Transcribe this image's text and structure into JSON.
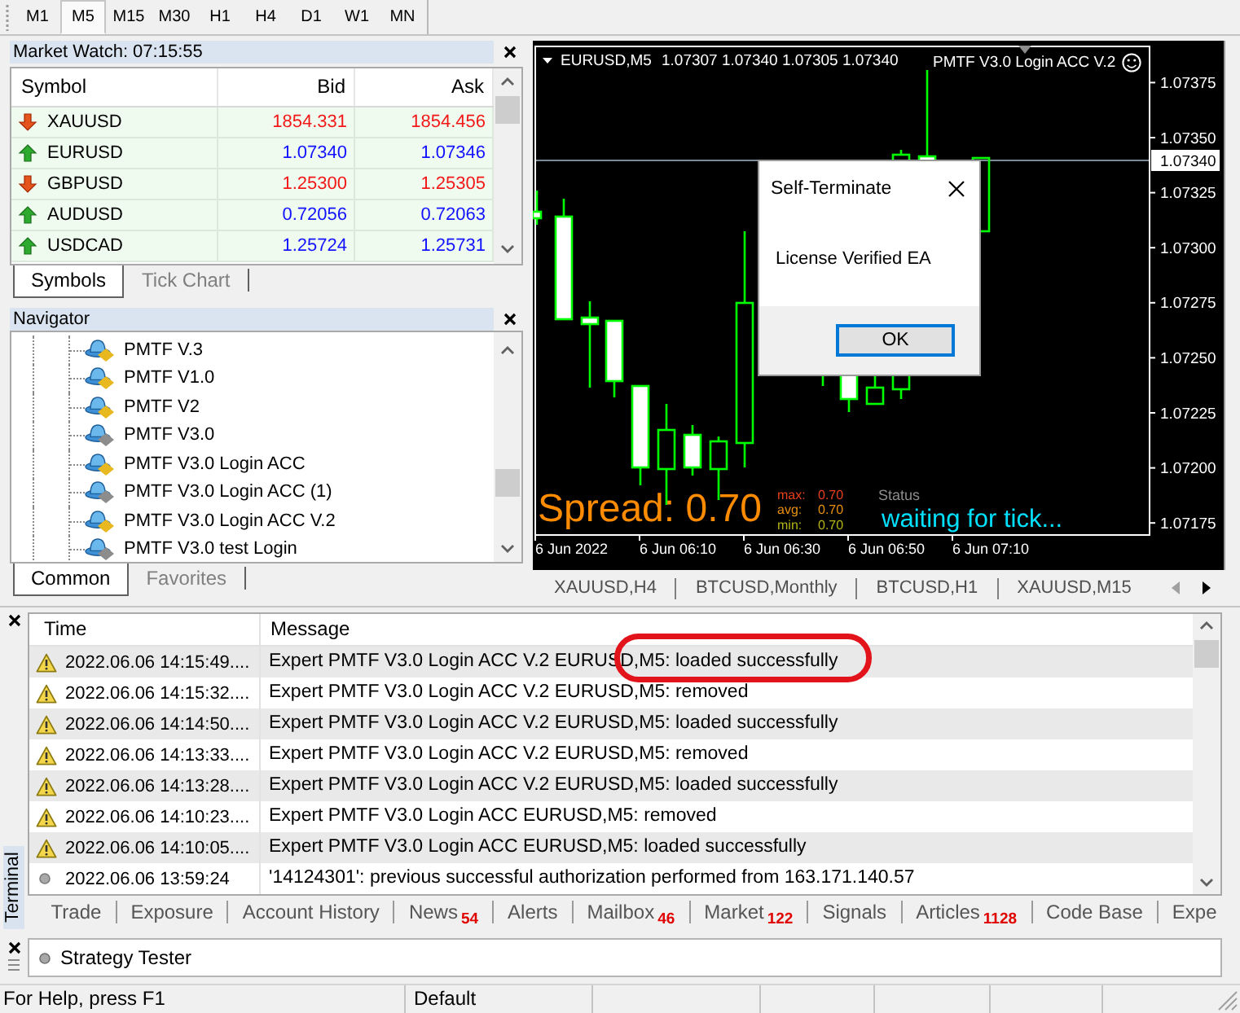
{
  "toolbar": {
    "timeframes": [
      {
        "label": "M1",
        "selected": false
      },
      {
        "label": "M5",
        "selected": true
      },
      {
        "label": "M15",
        "selected": false
      },
      {
        "label": "M30",
        "selected": false
      },
      {
        "label": "H1",
        "selected": false
      },
      {
        "label": "H4",
        "selected": false
      },
      {
        "label": "D1",
        "selected": false
      },
      {
        "label": "W1",
        "selected": false
      },
      {
        "label": "MN",
        "selected": false
      }
    ]
  },
  "market_watch": {
    "title": "Market Watch: 07:15:55",
    "columns": [
      "Symbol",
      "Bid",
      "Ask"
    ],
    "rows": [
      {
        "symbol": "XAUUSD",
        "kind": "down",
        "bid": "1854.331",
        "ask": "1854.456"
      },
      {
        "symbol": "EURUSD",
        "kind": "up",
        "bid": "1.07340",
        "ask": "1.07346"
      },
      {
        "symbol": "GBPUSD",
        "kind": "down",
        "bid": "1.25300",
        "ask": "1.25305"
      },
      {
        "symbol": "AUDUSD",
        "kind": "up",
        "bid": "0.72056",
        "ask": "0.72063"
      },
      {
        "symbol": "USDCAD",
        "kind": "up",
        "bid": "1.25724",
        "ask": "1.25731"
      }
    ],
    "tabs": [
      {
        "label": "Symbols",
        "selected": true
      },
      {
        "label": "Tick Chart",
        "selected": false
      }
    ]
  },
  "navigator": {
    "title": "Navigator",
    "items": [
      {
        "label": "PMTF V.3",
        "color": "#e8b820"
      },
      {
        "label": "PMTF V1.0",
        "color": "#e8b820"
      },
      {
        "label": "PMTF V2",
        "color": "#e8b820"
      },
      {
        "label": "PMTF V3.0",
        "color": "#8c8c8c"
      },
      {
        "label": "PMTF V3.0 Login ACC",
        "color": "#e8b820"
      },
      {
        "label": "PMTF V3.0 Login ACC (1)",
        "color": "#8c8c8c"
      },
      {
        "label": "PMTF V3.0 Login ACC V.2",
        "color": "#e8b820"
      },
      {
        "label": "PMTF V3.0 test Login",
        "color": "#8c8c8c"
      }
    ],
    "tabs": [
      {
        "label": "Common",
        "selected": true
      },
      {
        "label": "Favorites",
        "selected": false
      }
    ]
  },
  "chart": {
    "symbol": "EURUSD,M5",
    "ohlc": "1.07307 1.07340 1.07305 1.07340",
    "expert": "PMTF V3.0 Login ACC V.2",
    "price_labels": [
      "1.07375",
      "1.07350",
      "1.07325",
      "1.07300",
      "1.07275",
      "1.07250",
      "1.07225",
      "1.07200",
      "1.07175"
    ],
    "current_price": "1.07340",
    "time_labels": [
      "6 Jun 2022",
      "6 Jun 06:10",
      "6 Jun 06:30",
      "6 Jun 06:50",
      "6 Jun 07:10"
    ],
    "spread": "Spread: 0.70",
    "spread_stats": [
      {
        "label": "max:",
        "value": "0.70",
        "color": "#e8401c"
      },
      {
        "label": "avg:",
        "value": "0.70",
        "color": "#e8900c"
      },
      {
        "label": "min:",
        "value": "0.70",
        "color": "#b4b414"
      }
    ],
    "status_label": "Status",
    "status": "waiting for tick...",
    "dialog": {
      "title": "Self-Terminate",
      "message": "License Verified EA",
      "button": "OK"
    },
    "tabs": [
      "XAUUSD,H4",
      "BTCUSD,Monthly",
      "BTCUSD,H1",
      "XAUUSD,M15"
    ]
  },
  "terminal": {
    "title": "Terminal",
    "columns": [
      "Time",
      "Message"
    ],
    "rows": [
      {
        "kind": "warning",
        "time": "2022.06.06 14:15:49....",
        "message": "Expert PMTF V3.0 Login ACC V.2 EURUSD,M5: loaded successfully",
        "circled": true
      },
      {
        "kind": "warning",
        "time": "2022.06.06 14:15:32....",
        "message": "Expert PMTF V3.0 Login ACC V.2 EURUSD,M5: removed",
        "circled": false
      },
      {
        "kind": "warning",
        "time": "2022.06.06 14:14:50....",
        "message": "Expert PMTF V3.0 Login ACC V.2 EURUSD,M5: loaded successfully",
        "circled": false
      },
      {
        "kind": "warning",
        "time": "2022.06.06 14:13:33....",
        "message": "Expert PMTF V3.0 Login ACC V.2 EURUSD,M5: removed",
        "circled": false
      },
      {
        "kind": "warning",
        "time": "2022.06.06 14:13:28....",
        "message": "Expert PMTF V3.0 Login ACC V.2 EURUSD,M5: loaded successfully",
        "circled": false
      },
      {
        "kind": "warning",
        "time": "2022.06.06 14:10:23....",
        "message": "Expert PMTF V3.0 Login ACC EURUSD,M5: removed",
        "circled": false
      },
      {
        "kind": "warning",
        "time": "2022.06.06 14:10:05....",
        "message": "Expert PMTF V3.0 Login ACC EURUSD,M5: loaded successfully",
        "circled": false
      },
      {
        "kind": "info",
        "time": "2022.06.06 13:59:24",
        "message": "'14124301': previous successful authorization performed from 163.171.140.57",
        "circled": false
      }
    ],
    "tabs": [
      {
        "label": "Trade"
      },
      {
        "label": "Exposure"
      },
      {
        "label": "Account History"
      },
      {
        "label": "News",
        "badge": "54"
      },
      {
        "label": "Alerts"
      },
      {
        "label": "Mailbox",
        "badge": "46"
      },
      {
        "label": "Market",
        "badge": "122"
      },
      {
        "label": "Signals"
      },
      {
        "label": "Articles",
        "badge": "1128"
      },
      {
        "label": "Code Base"
      },
      {
        "label": "Expe"
      }
    ]
  },
  "strategy_tester": {
    "label": "Strategy Tester"
  },
  "status_bar": {
    "help": "For Help, press F1",
    "profile": "Default"
  }
}
